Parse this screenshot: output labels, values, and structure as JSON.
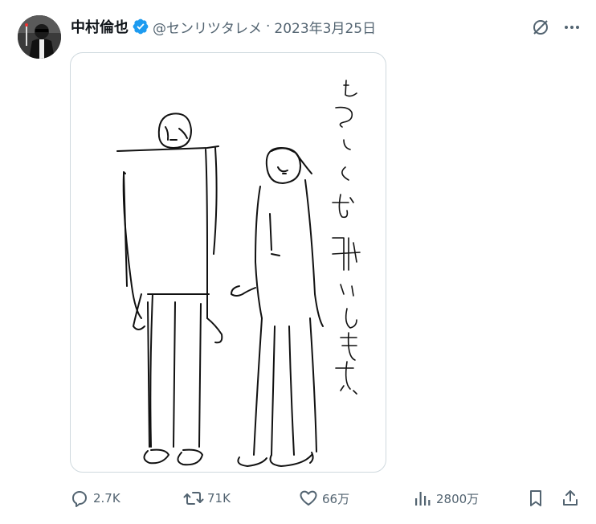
{
  "author": {
    "display_name": "中村倫也",
    "handle": "@センリツタレメ",
    "separator": "·",
    "date": "2023年3月25日",
    "verified": true
  },
  "media": {
    "handwritten_text": "よろしくお願いします。"
  },
  "actions": {
    "reply_count": "2.7K",
    "retweet_count": "71K",
    "like_count": "66万",
    "view_count": "2800万"
  },
  "icons": {
    "reply": "reply-icon",
    "retweet": "retweet-icon",
    "like": "heart-icon",
    "views": "views-icon",
    "bookmark": "bookmark-icon",
    "share": "share-icon",
    "grok": "grok-icon",
    "more": "more-icon",
    "verified": "verified-badge-icon"
  },
  "colors": {
    "text_primary": "#0f1419",
    "text_secondary": "#536471",
    "verified_blue": "#1d9bf0",
    "border": "#cfd9de"
  }
}
